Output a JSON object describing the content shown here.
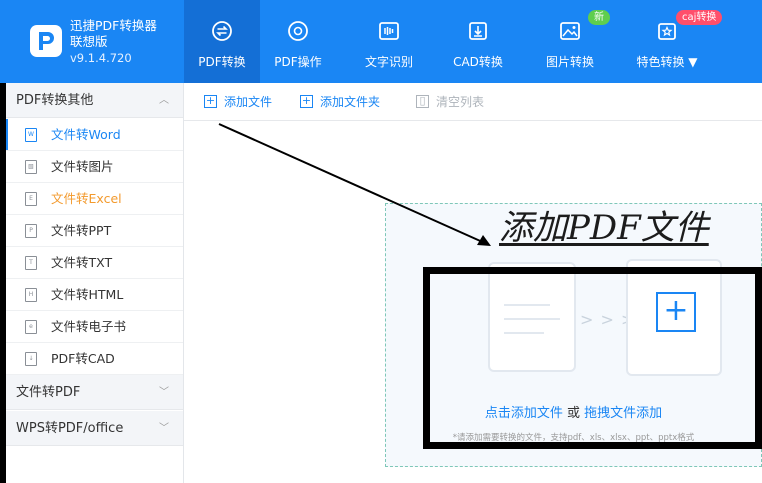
{
  "app": {
    "name": "迅捷PDF转换器",
    "edition": "联想版",
    "version": "v9.1.4.720"
  },
  "nav": [
    {
      "label": "PDF转换",
      "icon": "swap-circle-icon",
      "active": true
    },
    {
      "label": "PDF操作",
      "icon": "disc-icon"
    },
    {
      "label": "文字识别",
      "icon": "ocr-icon"
    },
    {
      "label": "CAD转换",
      "icon": "cad-icon"
    },
    {
      "label": "图片转换",
      "icon": "image-icon"
    },
    {
      "label": "特色转换 ▼",
      "icon": "star-swap-icon"
    }
  ],
  "badges": {
    "new": "新",
    "caj": "caj转换"
  },
  "sidebar": {
    "group1": "PDF转换其他",
    "items": [
      {
        "label": "文件转Word",
        "glyph": "W"
      },
      {
        "label": "文件转图片",
        "glyph": "▧"
      },
      {
        "label": "文件转Excel",
        "glyph": "E"
      },
      {
        "label": "文件转PPT",
        "glyph": "P"
      },
      {
        "label": "文件转TXT",
        "glyph": "T"
      },
      {
        "label": "文件转HTML",
        "glyph": "H"
      },
      {
        "label": "文件转电子书",
        "glyph": "e"
      },
      {
        "label": "PDF转CAD",
        "glyph": "↓"
      }
    ],
    "group2": "文件转PDF",
    "group3": "WPS转PDF/office"
  },
  "toolbar": {
    "add_file": "添加文件",
    "add_folder": "添加文件夹",
    "clear_list": "清空列表"
  },
  "main": {
    "annotation_title": "添加PDF文件",
    "hint_link1": "点击添加文件",
    "hint_or": " 或 ",
    "hint_link2": "拖拽文件添加",
    "hint_sub": "*请添加需要转换的文件，支持pdf、xls、xlsx、ppt、pptx格式"
  },
  "colors": {
    "brand": "#1a86f4",
    "active_nav": "#146fd6",
    "badge_new": "#5fce4e",
    "badge_caj": "#ff4f6b"
  }
}
